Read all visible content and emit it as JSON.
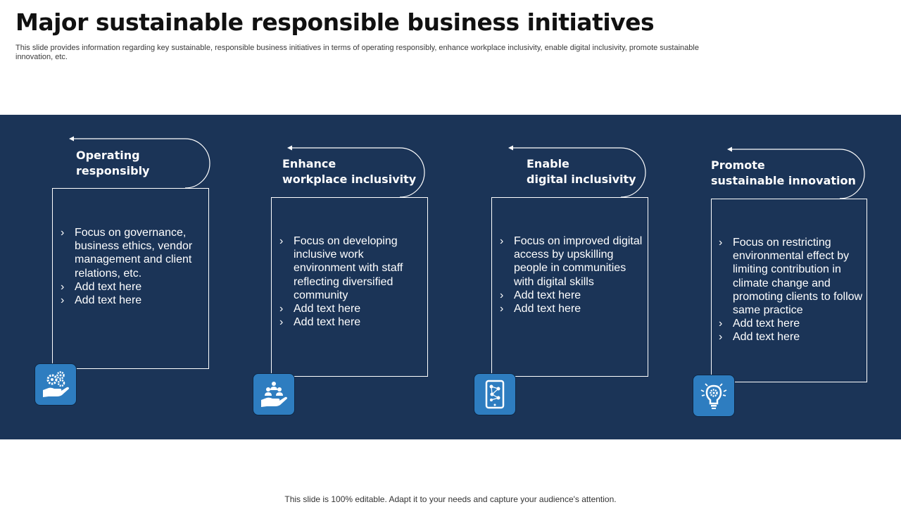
{
  "title": "Major sustainable responsible business initiatives",
  "subtitle": "This slide provides information regarding key sustainable, responsible business initiatives in terms of operating responsibly, enhance workplace inclusivity, enable digital inclusivity, promote sustainable innovation, etc.",
  "colors": {
    "band": "#1b3457",
    "icon_bg": "#2e7dc0",
    "text": "#ffffff"
  },
  "cards": [
    {
      "heading_line1": "Operating",
      "heading_line2": "responsibly",
      "icon": "hand-gears-icon",
      "bullets": [
        "Focus on governance, business ethics, vendor management and client relations, etc.",
        "Add text here",
        "Add text here"
      ]
    },
    {
      "heading_line1": "Enhance",
      "heading_line2": "workplace inclusivity",
      "icon": "hand-people-icon",
      "bullets": [
        "Focus on developing inclusive work environment with staff reflecting diversified community",
        "Add text here",
        "Add text here"
      ]
    },
    {
      "heading_line1": "Enable",
      "heading_line2": "digital inclusivity",
      "icon": "tablet-network-icon",
      "bullets": [
        "Focus on improved digital access by upskilling people in communities with digital skills",
        "Add text here",
        "Add text here"
      ]
    },
    {
      "heading_line1": "Promote",
      "heading_line2": "sustainable innovation",
      "icon": "lightbulb-gear-icon",
      "bullets": [
        "Focus on restricting environmental effect by limiting contribution in climate change and promoting clients to follow same practice",
        "Add text here",
        "Add text here"
      ]
    }
  ],
  "footer": "This slide is 100% editable. Adapt it to your needs and capture your audience's attention."
}
